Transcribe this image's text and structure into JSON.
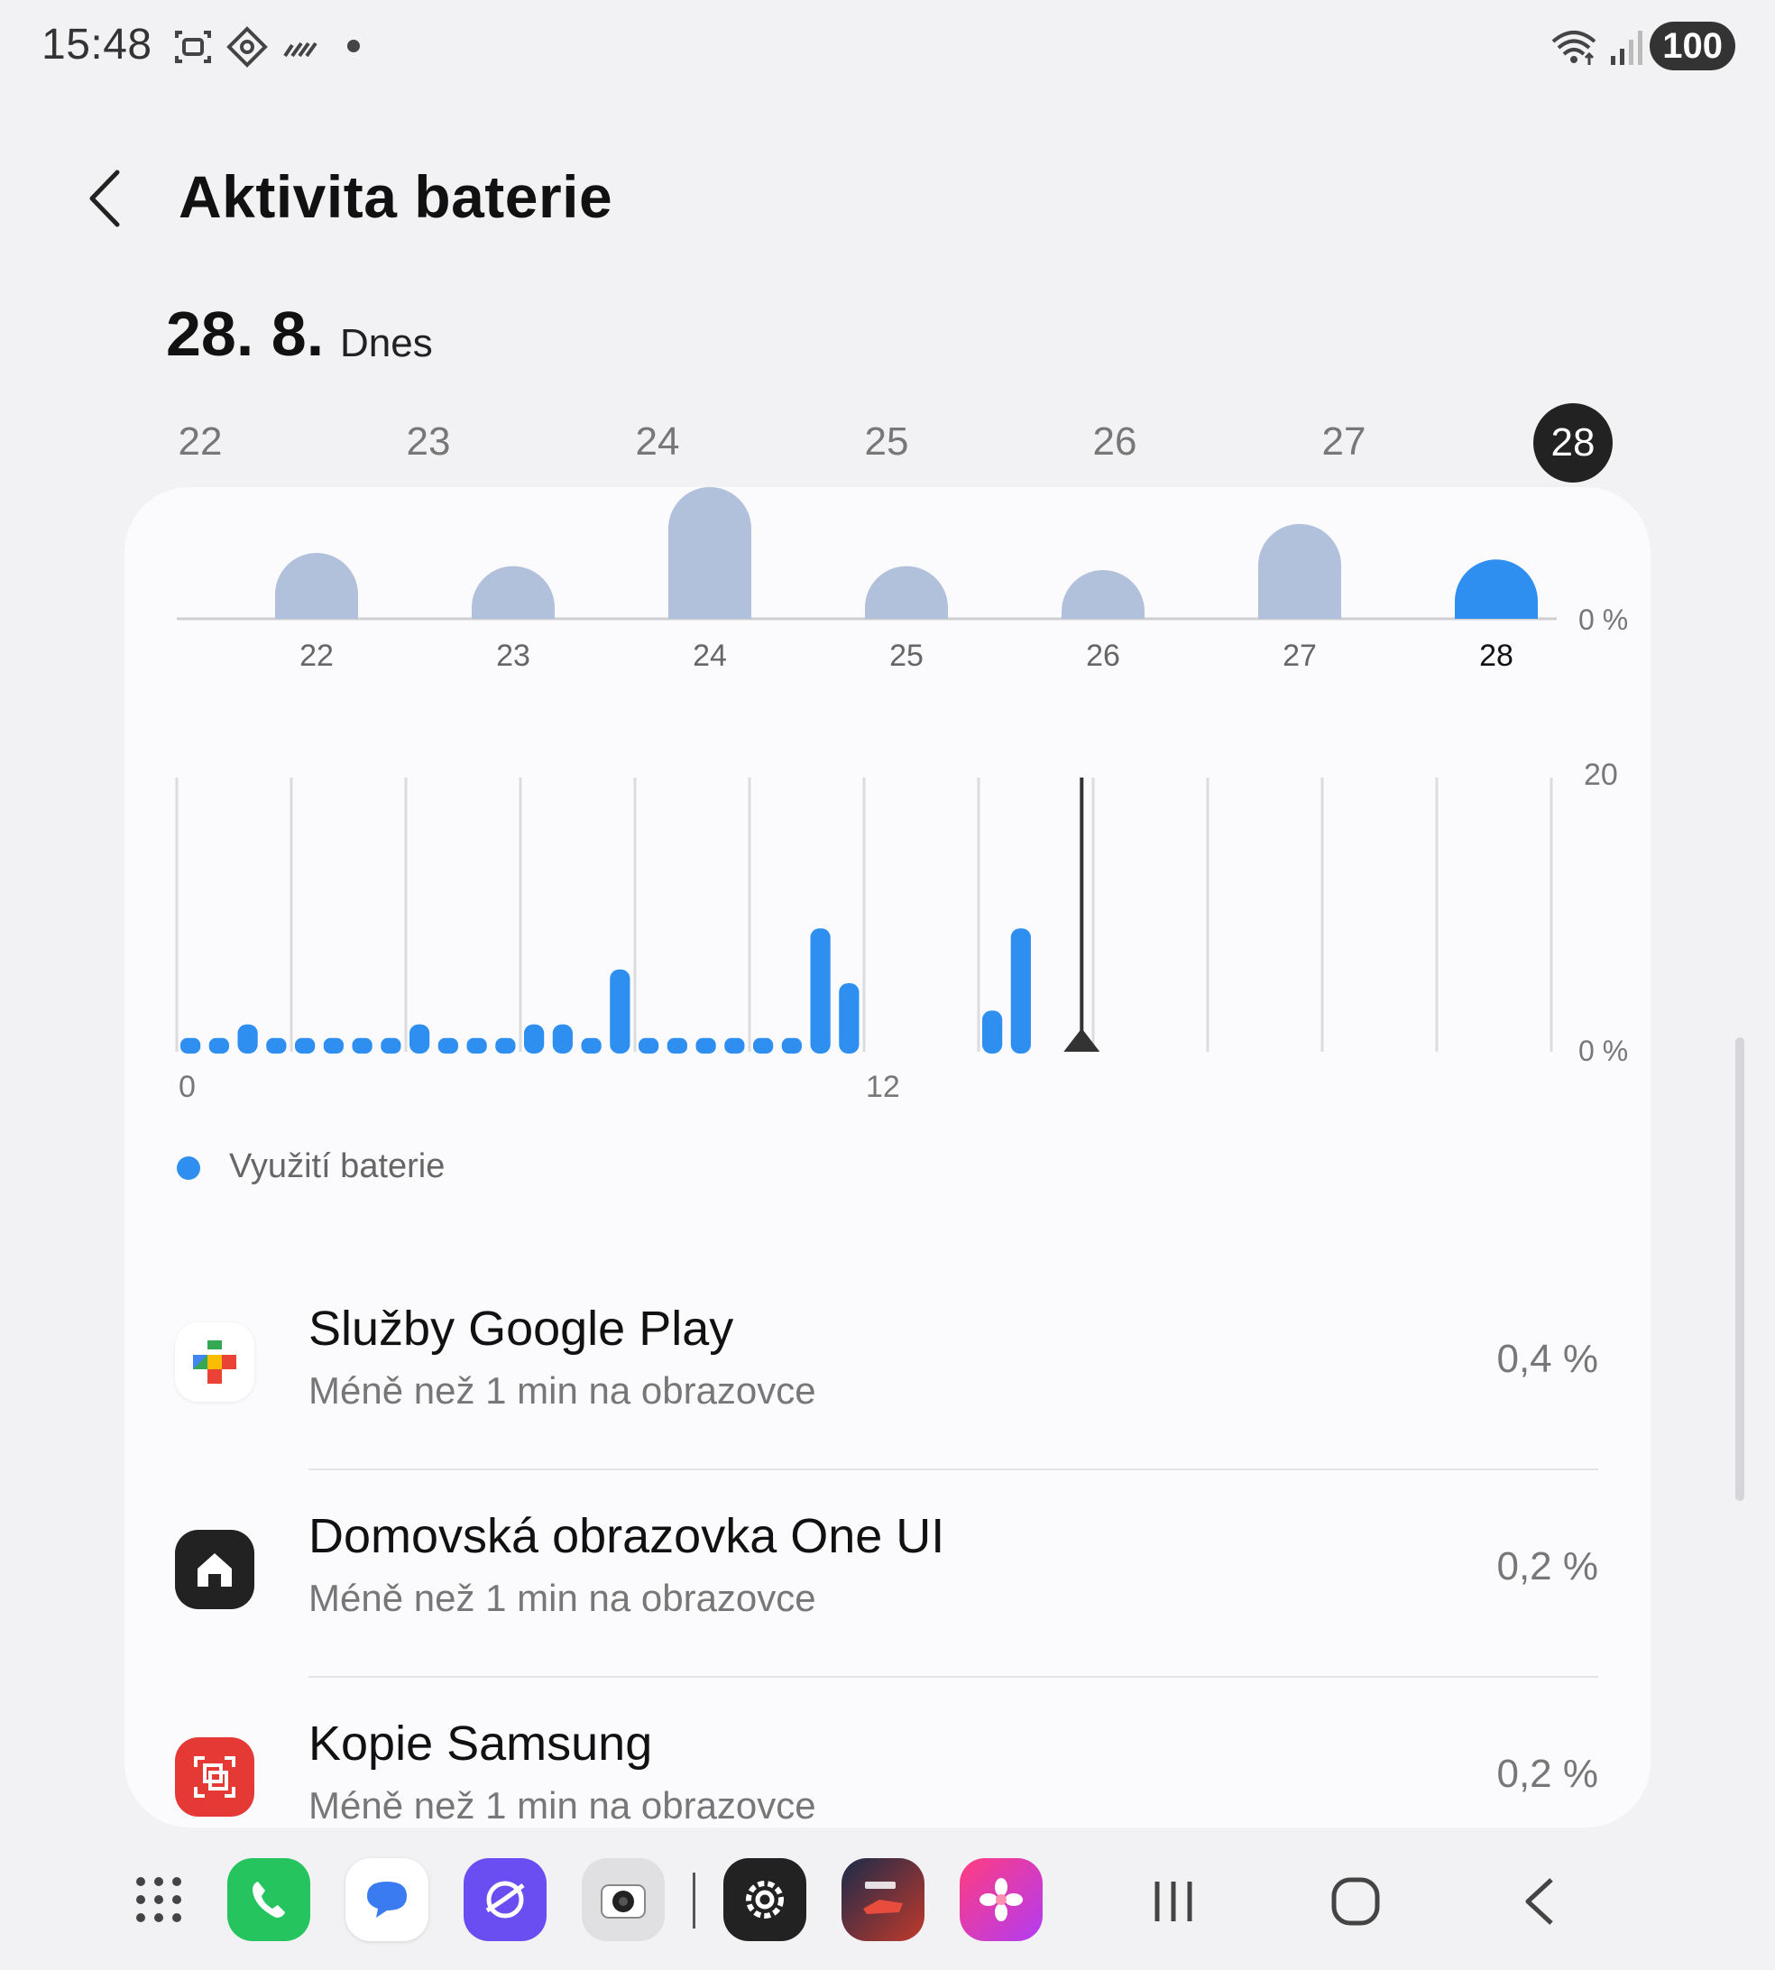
{
  "status_bar": {
    "time": "15:48",
    "battery": "100",
    "icons": [
      "screenshot-icon",
      "diamond-icon",
      "signal-bars-icon",
      "dot-icon",
      "wifi-icon",
      "cellular-icon"
    ]
  },
  "header": {
    "title": "Aktivita baterie",
    "back_icon": "chevron-left-icon"
  },
  "date": {
    "date": "28. 8.",
    "label": "Dnes"
  },
  "day_tabs": [
    {
      "label": "22",
      "active": false
    },
    {
      "label": "23",
      "active": false
    },
    {
      "label": "24",
      "active": false
    },
    {
      "label": "25",
      "active": false
    },
    {
      "label": "26",
      "active": false
    },
    {
      "label": "27",
      "active": false
    },
    {
      "label": "28",
      "active": true
    }
  ],
  "colors": {
    "bar_inactive": "#b2c1db",
    "bar_active": "#2f8ff0",
    "grid": "#dcdcdc",
    "marker": "#333333"
  },
  "chart_data": [
    {
      "type": "bar",
      "categories": [
        "22",
        "23",
        "24",
        "25",
        "26",
        "27",
        "28"
      ],
      "values": [
        0.5,
        0.4,
        1.0,
        0.4,
        0.37,
        0.72,
        0.45
      ],
      "highlight": "28",
      "y_tick_label": "0 %",
      "grid": false
    },
    {
      "type": "bar",
      "x": [
        0,
        0.5,
        1,
        1.5,
        2,
        2.5,
        3,
        3.5,
        4,
        4.5,
        5,
        5.5,
        6,
        6.5,
        7,
        7.5,
        8,
        8.5,
        9,
        9.5,
        10,
        10.5,
        11,
        11.5,
        12,
        12.5,
        13,
        13.5,
        14,
        14.5,
        15,
        15.5
      ],
      "values": [
        0.1,
        0.1,
        0.2,
        0.1,
        0.1,
        0.1,
        0.1,
        0.1,
        0.2,
        0.1,
        0.1,
        0.1,
        0.2,
        0.2,
        0.1,
        0.6,
        0.1,
        0.1,
        0.1,
        0.1,
        0.1,
        0.1,
        0.9,
        0.5,
        null,
        null,
        null,
        null,
        0.3,
        0.9,
        null,
        null
      ],
      "xlim": [
        0,
        24
      ],
      "ylim": [
        0,
        20
      ],
      "x_tick_labels": [
        {
          "x": 0,
          "label": "0"
        },
        {
          "x": 12,
          "label": "12"
        }
      ],
      "y_tick_labels": [
        "20",
        "0 %"
      ],
      "gridlines_x": [
        0,
        2,
        4,
        6,
        8,
        10,
        12,
        14,
        16,
        18,
        20,
        22,
        24
      ],
      "current_time": 15.8,
      "legend": {
        "label": "Využití baterie",
        "position": "bottom-left"
      },
      "grid": true
    }
  ],
  "apps": [
    {
      "name": "Služby Google Play",
      "subtitle": "Méně než 1 min na obrazovce",
      "percent": "0,4 %",
      "icon": "google-play-services-icon"
    },
    {
      "name": "Domovská obrazovka One UI",
      "subtitle": "Méně než 1 min na obrazovce",
      "percent": "0,2 %",
      "icon": "home-icon"
    },
    {
      "name": "Kopie Samsung",
      "subtitle": "Méně než 1 min na obrazovce",
      "percent": "0,2 %",
      "icon": "samsung-copy-icon"
    }
  ],
  "dock": {
    "apps": [
      "app-drawer-icon",
      "phone-icon",
      "messages-icon",
      "internet-icon",
      "camera-icon",
      "settings-icon",
      "game-icon",
      "gallery-icon"
    ],
    "nav": [
      "recents-icon",
      "home-nav-icon",
      "back-nav-icon"
    ]
  }
}
